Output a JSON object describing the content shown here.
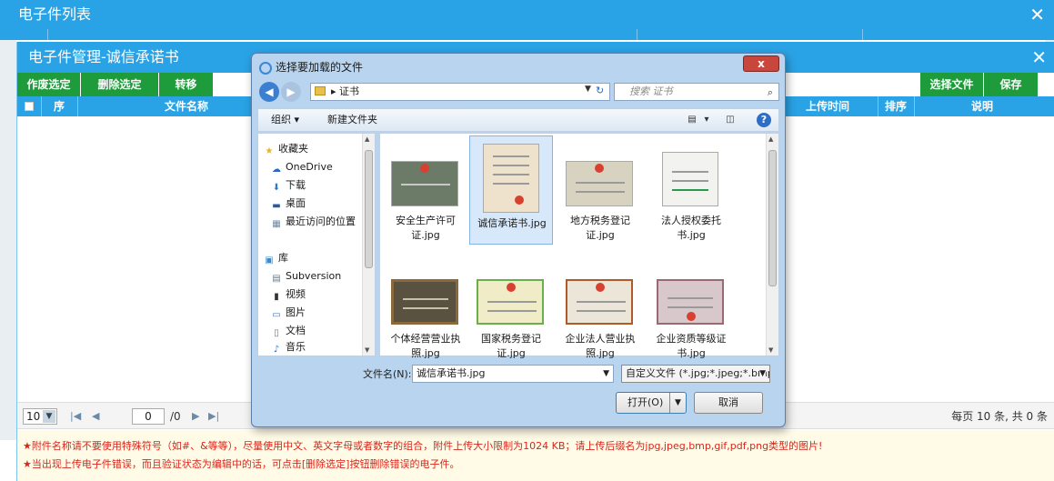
{
  "outer_window": {
    "title": "电子件列表",
    "close_icon": "✕"
  },
  "inner_window": {
    "title": "电子件管理-诚信承诺书",
    "close_icon": "✕"
  },
  "toolbar": {
    "void_selected": "作废选定",
    "delete_selected": "删除选定",
    "transfer": "转移",
    "choose_file": "选择文件",
    "save": "保存",
    "button_color": "#1e9b3a"
  },
  "table": {
    "header_color": "#2aa3e6",
    "columns": {
      "seq": "序",
      "file_name": "文件名称",
      "upload_time": "上传时间",
      "sort": "排序",
      "desc": "说明"
    }
  },
  "pager": {
    "page_size": "10",
    "current_page": "0",
    "total_pages": "/0",
    "summary": "每页 10 条, 共 0 条"
  },
  "notes": {
    "line1": "★附件名称请不要使用特殊符号（如#、&等等），尽量使用中文、英文字母或者数字的组合，附件上传大小限制为1024 KB；请上传后缀名为jpg,jpeg,bmp,gif,pdf,png类型的图片!",
    "line2": "★当出现上传电子件错误，而且验证状态为编辑中的话，可点击[删除选定]按钮删除错误的电子件。",
    "color": "#d8261c"
  },
  "dialog": {
    "title": "选择要加载的文件",
    "close_icon": "x",
    "address": "证书",
    "search_placeholder": "搜索 证书",
    "organize": "组织 ▾",
    "new_folder": "新建文件夹",
    "nav": {
      "favorites": "收藏夹",
      "onedrive": "OneDrive",
      "downloads": "下载",
      "desktop": "桌面",
      "recent": "最近访问的位置",
      "library": "库",
      "subversion": "Subversion",
      "videos": "视频",
      "pictures": "图片",
      "documents": "文档",
      "music": "音乐"
    },
    "files": [
      {
        "name": "安全生产许可证.jpg"
      },
      {
        "name": "诚信承诺书.jpg"
      },
      {
        "name": "地方税务登记证.jpg"
      },
      {
        "name": "法人授权委托书.jpg"
      },
      {
        "name": "个体经营营业执照.jpg"
      },
      {
        "name": "国家税务登记证.jpg"
      },
      {
        "name": "企业法人营业执照.jpg"
      },
      {
        "name": "企业资质等级证书.jpg"
      }
    ],
    "filename_label": "文件名(N):",
    "filename_value": "诚信承诺书.jpg",
    "filetype_value": "自定义文件 (*.jpg;*.jpeg;*.bmp",
    "open_button": "打开(O)",
    "cancel_button": "取消"
  }
}
